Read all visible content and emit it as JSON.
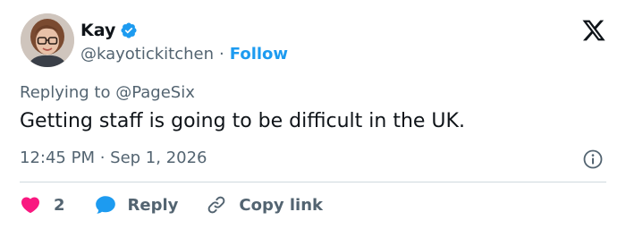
{
  "author": {
    "name": "Kay",
    "handle": "@kayotickitchen",
    "separator": "·",
    "follow_label": "Follow",
    "verified_icon": "verified-badge-icon"
  },
  "reply_context": {
    "prefix": "Replying to",
    "mention": "@PageSix"
  },
  "tweet": {
    "text": "Getting staff is going to be difficult in the UK.",
    "timestamp": "12:45 PM · Sep 1, 2026"
  },
  "actions": {
    "like_count": "2",
    "reply_label": "Reply",
    "copy_link_label": "Copy link"
  },
  "icons": {
    "logo": "x-logo-icon",
    "info": "info-icon",
    "like": "heart-icon",
    "reply": "speech-bubble-icon",
    "copy": "link-icon"
  },
  "colors": {
    "accent": "#1d9bf0",
    "like": "#f91880",
    "text": "#0f1419",
    "secondary": "#536471",
    "divider": "#cfd9de"
  }
}
